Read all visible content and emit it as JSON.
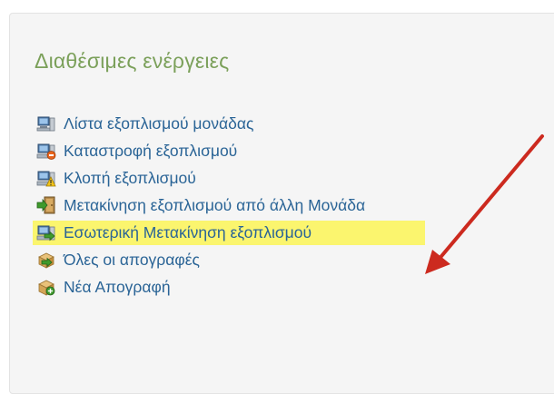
{
  "panel": {
    "title": "Διαθέσιμες ενέργειες"
  },
  "actions": [
    {
      "label": "Λίστα εξοπλισμού μονάδας",
      "icon": "computer-list-icon"
    },
    {
      "label": "Καταστροφή εξοπλισμού",
      "icon": "computer-destroy-icon"
    },
    {
      "label": "Κλοπή εξοπλισμού",
      "icon": "computer-warning-icon"
    },
    {
      "label": "Μετακίνηση εξοπλισμού από άλλη Μονάδα",
      "icon": "door-transfer-icon"
    },
    {
      "label": "Εσωτερική Μετακίνηση εξοπλισμού",
      "icon": "computer-move-icon",
      "highlighted": true
    },
    {
      "label": "Όλες οι απογραφές",
      "icon": "box-arrow-icon"
    },
    {
      "label": "Νέα Απογραφή",
      "icon": "box-add-icon"
    }
  ],
  "colors": {
    "title": "#7ba05a",
    "link": "#2a6496",
    "highlight": "#fbf56e",
    "arrow": "#cc2a1f"
  }
}
